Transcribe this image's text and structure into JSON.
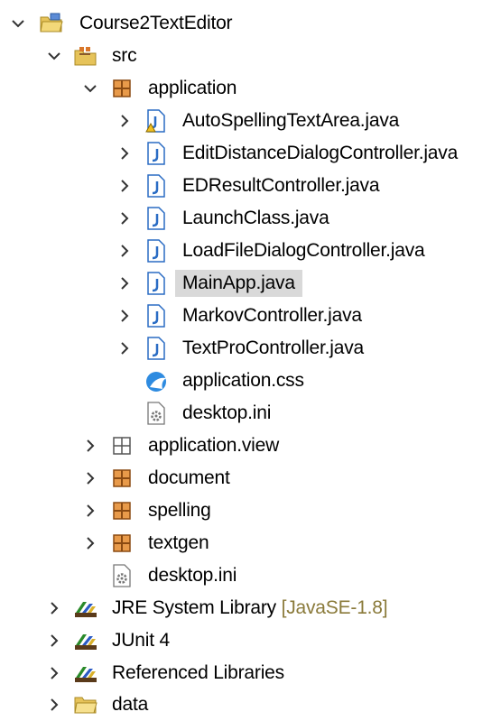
{
  "tree": {
    "project": {
      "label": "Course2TextEditor",
      "icon": "java-project-icon",
      "expanded": true
    },
    "src": {
      "label": "src",
      "icon": "source-folder-icon",
      "expanded": true
    },
    "application": {
      "label": "application",
      "icon": "package-icon",
      "expanded": true
    },
    "files": [
      {
        "label": "AutoSpellingTextArea.java",
        "icon": "java-file-warning-icon",
        "chevron": true
      },
      {
        "label": "EditDistanceDialogController.java",
        "icon": "java-file-icon",
        "chevron": true
      },
      {
        "label": "EDResultController.java",
        "icon": "java-file-icon",
        "chevron": true
      },
      {
        "label": "LaunchClass.java",
        "icon": "java-file-icon",
        "chevron": true
      },
      {
        "label": "LoadFileDialogController.java",
        "icon": "java-file-icon",
        "chevron": true
      },
      {
        "label": "MainApp.java",
        "icon": "java-file-icon",
        "chevron": true,
        "selected": true
      },
      {
        "label": "MarkovController.java",
        "icon": "java-file-icon",
        "chevron": true
      },
      {
        "label": "TextProController.java",
        "icon": "java-file-icon",
        "chevron": true
      },
      {
        "label": "application.css",
        "icon": "css-file-icon",
        "chevron": false
      },
      {
        "label": "desktop.ini",
        "icon": "settings-file-icon",
        "chevron": false
      }
    ],
    "packages": [
      {
        "label": "application.view",
        "icon": "empty-package-icon"
      },
      {
        "label": "document",
        "icon": "package-icon"
      },
      {
        "label": "spelling",
        "icon": "package-icon"
      },
      {
        "label": "textgen",
        "icon": "package-icon"
      }
    ],
    "src_file": {
      "label": "desktop.ini",
      "icon": "settings-file-icon"
    },
    "libraries": [
      {
        "label": "JRE System Library",
        "suffix": "[JavaSE-1.8]",
        "icon": "library-icon"
      },
      {
        "label": "JUnit 4",
        "suffix": "",
        "icon": "library-icon"
      },
      {
        "label": "Referenced Libraries",
        "suffix": "",
        "icon": "library-icon"
      }
    ],
    "data_folder": {
      "label": "data",
      "icon": "folder-icon"
    }
  },
  "colors": {
    "selection": "#d9d9d9",
    "chevron": "#333333",
    "package_orange": "#d9772a",
    "java_blue": "#2a6cc4",
    "library_suffix": "#8a7a3a"
  }
}
